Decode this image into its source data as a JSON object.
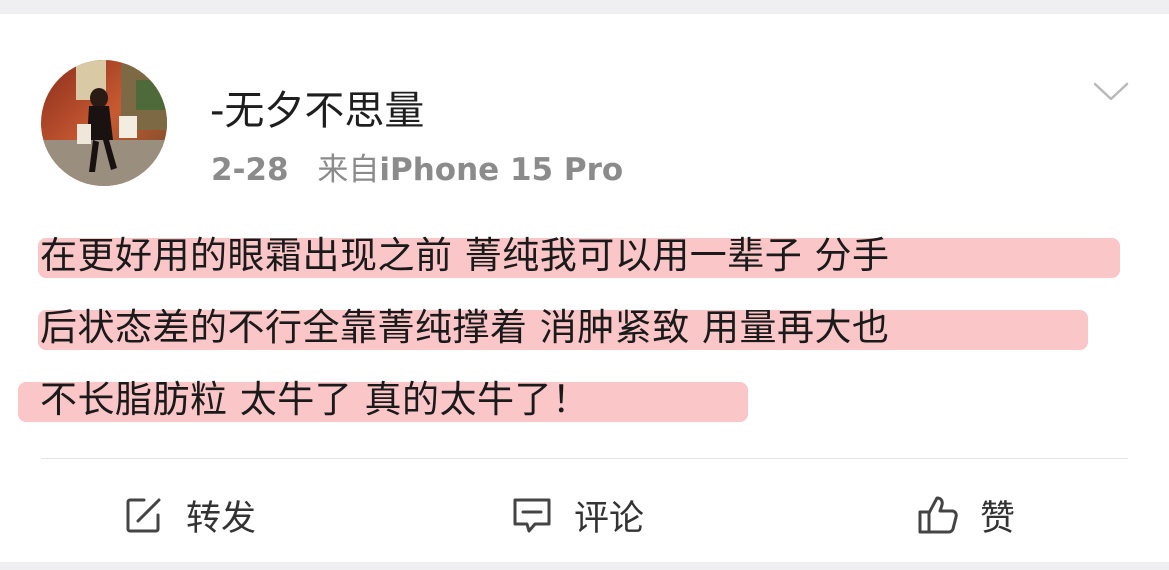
{
  "post": {
    "username": "-无夕不思量",
    "date": "2-28",
    "source_prefix": "来自",
    "source_device": "iPhone 15 Pro",
    "lines": [
      "在更好用的眼霜出现之前 菁纯我可以用一辈子 分手",
      "后状态差的不行全靠菁纯撑着 消肿紧致 用量再大也",
      "不长脂肪粒 太牛了 真的太牛了！"
    ],
    "highlight_color": "#fbc6c8"
  },
  "actions": {
    "repost_label": "转发",
    "comment_label": "评论",
    "like_label": "赞"
  },
  "icons": {
    "more": "chevron-down-icon",
    "repost": "repost-icon",
    "comment": "comment-icon",
    "like": "thumbs-up-icon"
  }
}
